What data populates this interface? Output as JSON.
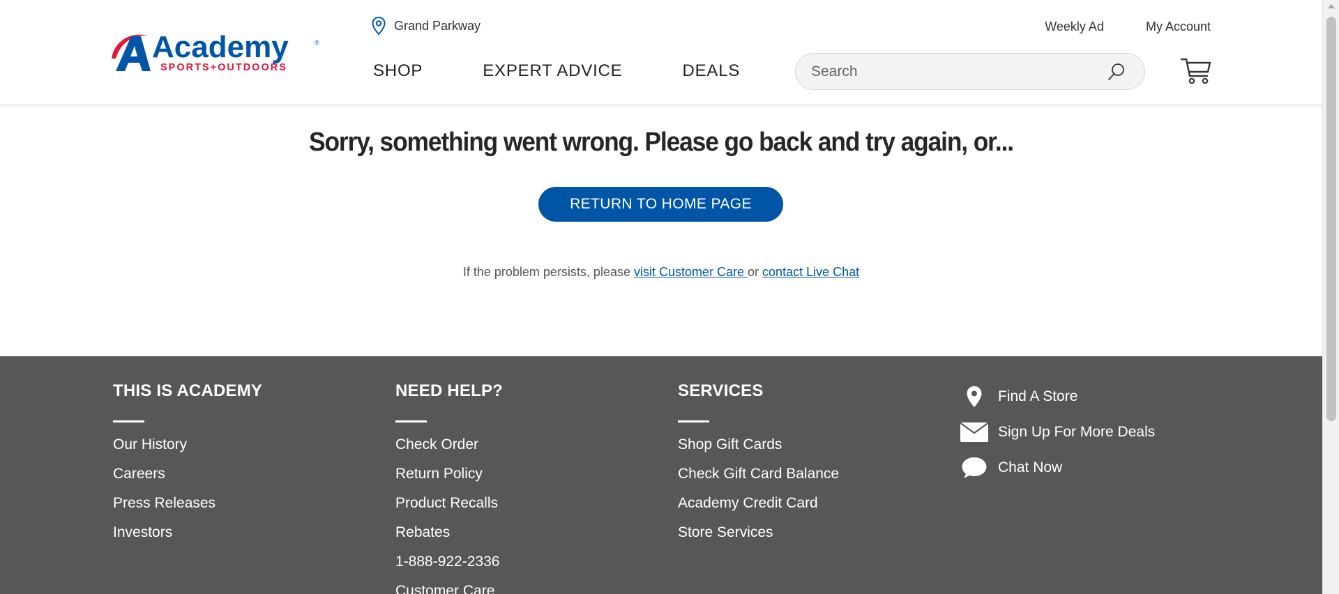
{
  "header": {
    "logo": {
      "wordmark": "Academy",
      "tagline": "SPORTS+OUTDOORS",
      "registered": "®",
      "icon": "academy-a-logo"
    },
    "location": {
      "icon": "map-pin-icon",
      "label": "Grand Parkway"
    },
    "utility_links": [
      {
        "label": "Weekly Ad"
      },
      {
        "label": "My Account"
      }
    ],
    "nav": [
      {
        "label": "SHOP"
      },
      {
        "label": "EXPERT ADVICE"
      },
      {
        "label": "DEALS"
      }
    ],
    "search": {
      "placeholder": "Search",
      "icon": "search-icon"
    },
    "cart_icon": "cart-icon"
  },
  "error": {
    "title": "Sorry, something went wrong. Please go back and try again, or...",
    "button_label": "RETURN TO HOME PAGE",
    "persist_prefix": "If the problem persists, please ",
    "customer_care_link": "visit Customer Care ",
    "or_text": " or ",
    "live_chat_link": "contact Live Chat"
  },
  "footer": {
    "columns": [
      {
        "heading": "THIS IS ACADEMY",
        "links": [
          "Our History",
          "Careers",
          "Press Releases",
          "Investors"
        ]
      },
      {
        "heading": "NEED HELP?",
        "links": [
          "Check Order",
          "Return Policy",
          "Product Recalls",
          "Rebates",
          "1-888-922-2336",
          "Customer Care"
        ]
      },
      {
        "heading": "SERVICES",
        "links": [
          "Shop Gift Cards",
          "Check Gift Card Balance",
          "Academy Credit Card",
          "Store Services"
        ]
      }
    ],
    "quick_links": [
      {
        "label": "Find A Store",
        "icon": "location-pin-icon"
      },
      {
        "label": "Sign Up For More Deals",
        "icon": "envelope-icon"
      },
      {
        "label": "Chat Now",
        "icon": "chat-bubble-icon"
      }
    ]
  },
  "colors": {
    "brand_blue": "#0055a6",
    "brand_red": "#e31837",
    "footer_bg": "#575757"
  }
}
